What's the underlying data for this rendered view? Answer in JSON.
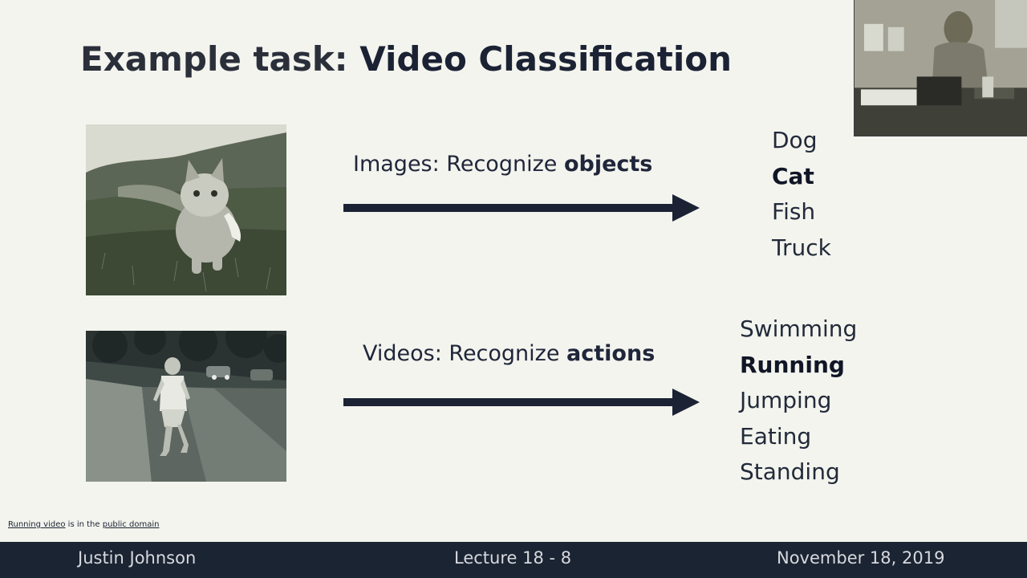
{
  "slide": {
    "title_prefix": "Example task: ",
    "title_emphasis": "Video Classification"
  },
  "images_row": {
    "caption_prefix": "Images: Recognize ",
    "caption_bold": "objects",
    "labels": [
      {
        "text": "Dog",
        "bold": false
      },
      {
        "text": "Cat",
        "bold": true
      },
      {
        "text": "Fish",
        "bold": false
      },
      {
        "text": "Truck",
        "bold": false
      }
    ]
  },
  "videos_row": {
    "caption_prefix": "Videos: Recognize ",
    "caption_bold": "actions",
    "labels": [
      {
        "text": "Swimming",
        "bold": false
      },
      {
        "text": "Running",
        "bold": true
      },
      {
        "text": "Jumping",
        "bold": false
      },
      {
        "text": "Eating",
        "bold": false
      },
      {
        "text": "Standing",
        "bold": false
      }
    ]
  },
  "credit": {
    "link1": "Running video",
    "middle": " is in the ",
    "link2": "public domain"
  },
  "footer": {
    "author": "Justin Johnson",
    "lecture": "Lecture 18 - 8",
    "date": "November 18, 2019"
  },
  "colors": {
    "background": "#f3f4ee",
    "arrow": "#1b2234",
    "footer_bg": "#1b2432",
    "footer_text": "#d6d9de"
  }
}
